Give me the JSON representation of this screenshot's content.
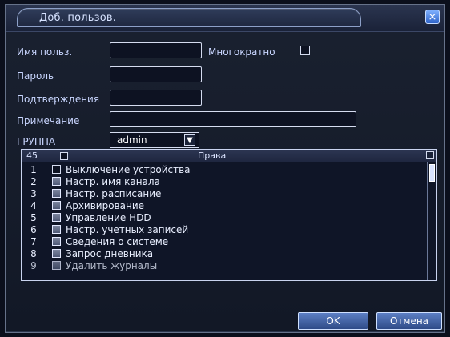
{
  "window": {
    "title": "Доб. пользов.",
    "close_icon": "close-icon"
  },
  "form": {
    "username_label": "Имя польз.",
    "username_value": "",
    "reuse_label": "Многократно",
    "password_label": "Пароль",
    "password_value": "",
    "confirm_label": "Подтверждения",
    "confirm_value": "",
    "note_label": "Примечание",
    "note_value": "",
    "group_label": "ГРУППА",
    "group_value": "admin"
  },
  "permissions": {
    "count": "45",
    "header": "Права",
    "rows": [
      {
        "num": "1",
        "label": "Выключение устройства",
        "checked": false
      },
      {
        "num": "2",
        "label": "Настр. имя канала",
        "checked": true
      },
      {
        "num": "3",
        "label": "Настр. расписание",
        "checked": true
      },
      {
        "num": "4",
        "label": "Архивирование",
        "checked": true
      },
      {
        "num": "5",
        "label": "Управление HDD",
        "checked": true
      },
      {
        "num": "6",
        "label": "Настр. учетных записей",
        "checked": true
      },
      {
        "num": "7",
        "label": "Сведения о системе",
        "checked": true
      },
      {
        "num": "8",
        "label": "Запрос дневника",
        "checked": true
      },
      {
        "num": "9",
        "label": "Удалить журналы",
        "checked": true
      }
    ]
  },
  "buttons": {
    "ok": "OK",
    "cancel": "Отмена"
  }
}
